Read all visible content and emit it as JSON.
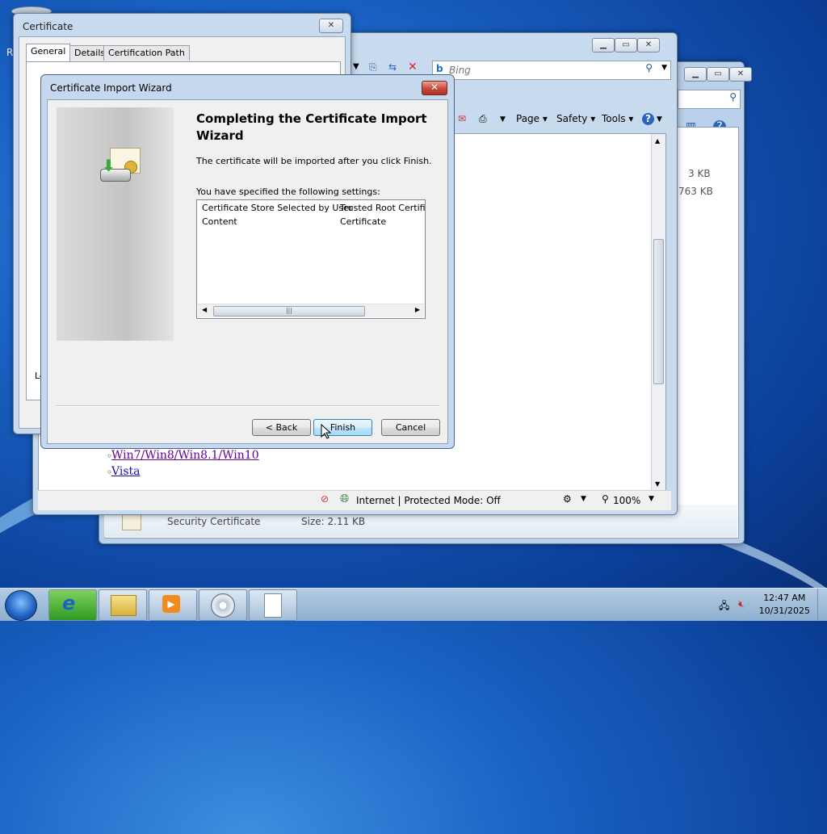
{
  "explorer": {
    "file_size_1": "3 KB",
    "file_size_2": "763 KB",
    "file_type": "Security Certificate",
    "file_size_label": "Size: 2.11 KB"
  },
  "ie": {
    "search_provider": "Bing",
    "cmd_page": "Page",
    "cmd_safety": "Safety",
    "cmd_tools": "Tools",
    "links": [
      "Win7/Win8/Win8.1/Win10",
      "Vista"
    ],
    "status_zone": "Internet | Protected Mode: Off",
    "zoom": "100%"
  },
  "cert": {
    "title": "Certificate",
    "tabs": [
      "General",
      "Details",
      "Certification Path"
    ],
    "partial_text": "Le"
  },
  "wizard": {
    "title": "Certificate Import Wizard",
    "heading": "Completing the Certificate Import Wizard",
    "description": "The certificate will be imported after you click Finish.",
    "settings_label": "You have specified the following settings:",
    "settings": [
      {
        "key": "Certificate Store Selected by User",
        "value": "Trusted Root Certifica"
      },
      {
        "key": "Content",
        "value": "Certificate"
      }
    ],
    "back_label": "< Back",
    "finish_label": "Finish",
    "cancel_label": "Cancel"
  },
  "desktop": {
    "partial_label": "R"
  },
  "taskbar": {
    "time": "12:47 AM",
    "date": "10/31/2025"
  },
  "colors": {
    "desktop": "#1a63c4",
    "wizard_close": "#c9473a",
    "default_button": "#bee6fd"
  }
}
